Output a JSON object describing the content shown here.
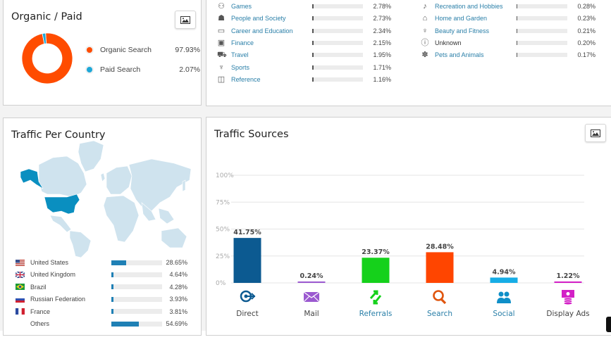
{
  "organic_paid": {
    "title": "Organic / Paid",
    "export_icon": "image-icon",
    "items": [
      {
        "label": "Organic Search",
        "value": "97.93%",
        "pct": 97.93,
        "color": "#ff4c00"
      },
      {
        "label": "Paid Search",
        "value": "2.07%",
        "pct": 2.07,
        "color": "#1da8d8"
      }
    ]
  },
  "categories": {
    "left": [
      {
        "icon": "gamepad-icon",
        "glyph": "⚇",
        "label": "Games",
        "value": "2.78%",
        "pct": 2.78
      },
      {
        "icon": "people-icon",
        "glyph": "☗",
        "label": "People and Society",
        "value": "2.73%",
        "pct": 2.73
      },
      {
        "icon": "briefcase-icon",
        "glyph": "▭",
        "label": "Career and Education",
        "value": "2.34%",
        "pct": 2.34
      },
      {
        "icon": "wallet-icon",
        "glyph": "▣",
        "label": "Finance",
        "value": "2.15%",
        "pct": 2.15
      },
      {
        "icon": "train-icon",
        "glyph": "⛟",
        "label": "Travel",
        "value": "1.95%",
        "pct": 1.95
      },
      {
        "icon": "trophy-icon",
        "glyph": "♆",
        "label": "Sports",
        "value": "1.71%",
        "pct": 1.71
      },
      {
        "icon": "book-icon",
        "glyph": "◫",
        "label": "Reference",
        "value": "1.16%",
        "pct": 1.16
      }
    ],
    "right": [
      {
        "icon": "guitar-icon",
        "glyph": "♪",
        "label": "Recreation and Hobbies",
        "value": "0.28%",
        "pct": 0.28,
        "link": true
      },
      {
        "icon": "home-icon",
        "glyph": "⌂",
        "label": "Home and Garden",
        "value": "0.23%",
        "pct": 0.23,
        "link": true
      },
      {
        "icon": "fitness-icon",
        "glyph": "♀",
        "label": "Beauty and Fitness",
        "value": "0.21%",
        "pct": 0.21,
        "link": true
      },
      {
        "icon": "alert-circle-icon",
        "glyph": "ⓘ",
        "label": "Unknown",
        "value": "0.20%",
        "pct": 0.2,
        "link": false
      },
      {
        "icon": "paw-icon",
        "glyph": "✽",
        "label": "Pets and Animals",
        "value": "0.17%",
        "pct": 0.17,
        "link": true
      }
    ]
  },
  "country": {
    "title": "Traffic Per Country",
    "rows": [
      {
        "flag": "us",
        "name": "United States",
        "value": "28.65%",
        "pct": 28.65
      },
      {
        "flag": "uk",
        "name": "United Kingdom",
        "value": "4.64%",
        "pct": 4.64
      },
      {
        "flag": "br",
        "name": "Brazil",
        "value": "4.28%",
        "pct": 4.28
      },
      {
        "flag": "ru",
        "name": "Russian Federation",
        "value": "3.93%",
        "pct": 3.93
      },
      {
        "flag": "fr",
        "name": "France",
        "value": "3.81%",
        "pct": 3.81
      },
      {
        "flag": "",
        "name": "Others",
        "value": "54.69%",
        "pct": 54.69
      }
    ],
    "highlight_color": "#0a8fc0"
  },
  "sources": {
    "title": "Traffic Sources",
    "export_icon": "image-icon"
  },
  "chart_data": {
    "type": "bar",
    "title": "Traffic Sources",
    "xlabel": "",
    "ylabel": "",
    "ylim": [
      0,
      100
    ],
    "yticks": [
      "0%",
      "25%",
      "50%",
      "75%",
      "100%"
    ],
    "ytick_values": [
      0,
      25,
      50,
      75,
      100
    ],
    "grid": true,
    "categories": [
      "Direct",
      "Mail",
      "Referrals",
      "Search",
      "Social",
      "Display Ads"
    ],
    "values": [
      41.75,
      0.24,
      23.37,
      28.48,
      4.94,
      1.22
    ],
    "labels": [
      "41.75%",
      "0.24%",
      "23.37%",
      "28.48%",
      "4.94%",
      "1.22%"
    ],
    "colors": [
      "#0c5a91",
      "#9b59d0",
      "#15d11b",
      "#ff4500",
      "#16ade6",
      "#d31fc6"
    ],
    "icons": [
      "direct-icon",
      "mail-icon",
      "referrals-icon",
      "search-icon",
      "social-icon",
      "display-ads-icon"
    ],
    "label_link": [
      false,
      false,
      true,
      true,
      true,
      false
    ]
  }
}
